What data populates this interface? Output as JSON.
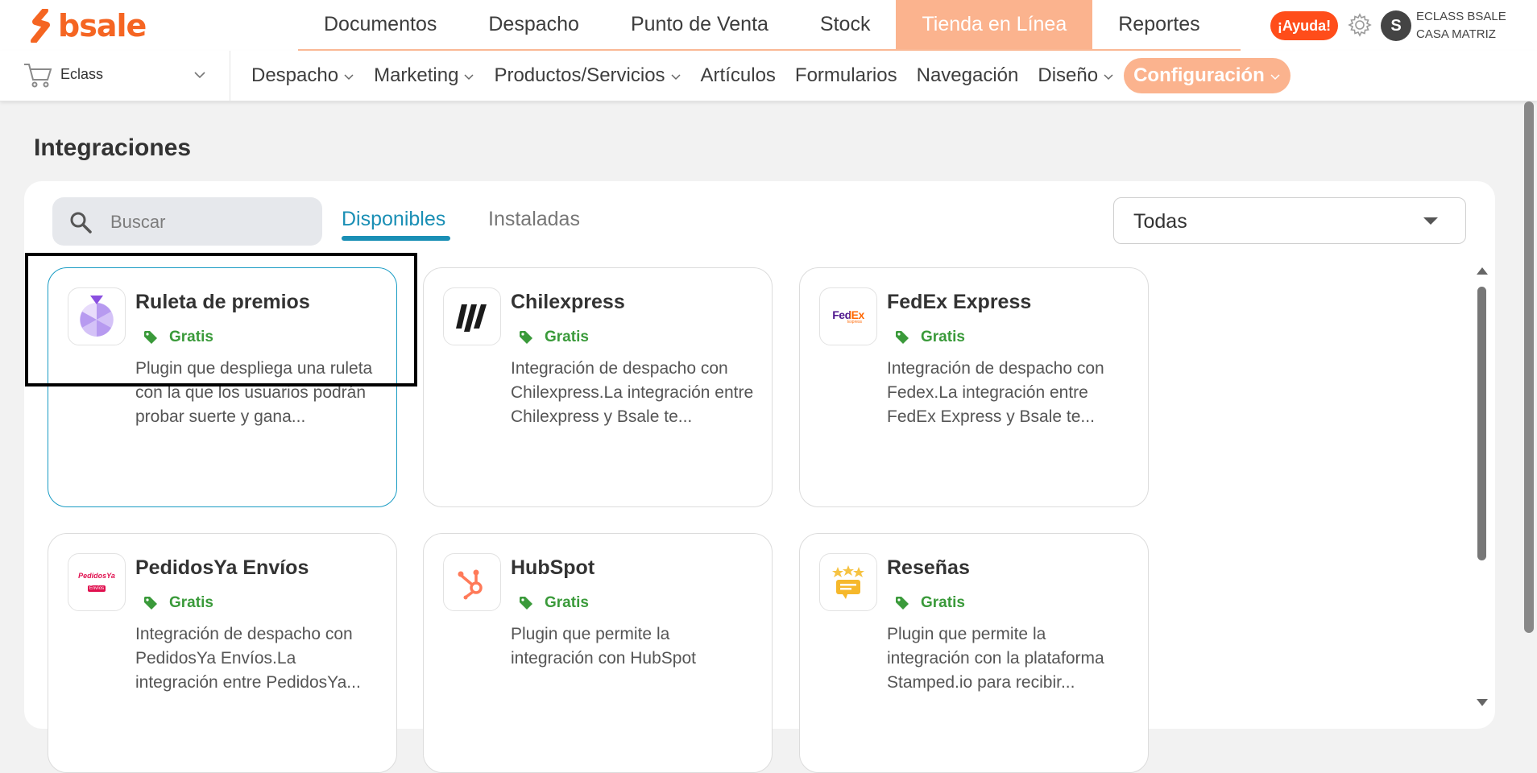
{
  "brand": {
    "name": "bsale",
    "color": "#f56522"
  },
  "main_nav": [
    {
      "label": "Documentos",
      "active": false
    },
    {
      "label": "Despacho",
      "active": false
    },
    {
      "label": "Punto de Venta",
      "active": false
    },
    {
      "label": "Stock",
      "active": false
    },
    {
      "label": "Tienda en Línea",
      "active": true
    },
    {
      "label": "Reportes",
      "active": false
    }
  ],
  "header": {
    "help_label": "¡Ayuda!",
    "avatar_initial": "S",
    "company_line1": "ECLASS BSALE",
    "company_line2": "CASA MATRIZ"
  },
  "store": {
    "name": "Eclass"
  },
  "sub_nav": [
    {
      "label": "Despacho",
      "has_menu": true,
      "active": false
    },
    {
      "label": "Marketing",
      "has_menu": true,
      "active": false
    },
    {
      "label": "Productos/Servicios",
      "has_menu": true,
      "active": false
    },
    {
      "label": "Artículos",
      "has_menu": false,
      "active": false
    },
    {
      "label": "Formularios",
      "has_menu": false,
      "active": false
    },
    {
      "label": "Navegación",
      "has_menu": false,
      "active": false
    },
    {
      "label": "Diseño",
      "has_menu": true,
      "active": false
    },
    {
      "label": "Configuración",
      "has_menu": true,
      "active": true
    }
  ],
  "page": {
    "title": "Integraciones"
  },
  "search": {
    "placeholder": "Buscar",
    "value": ""
  },
  "tabs": {
    "available": "Disponibles",
    "installed": "Instaladas",
    "active": "available"
  },
  "filter": {
    "selected": "Todas"
  },
  "integrations": [
    {
      "name": "Ruleta de premios",
      "price": "Gratis",
      "description": "Plugin que despliega una ruleta con la que los usuarios podrán probar suerte y gana...",
      "icon": "prize-wheel-icon",
      "selected": true
    },
    {
      "name": "Chilexpress",
      "price": "Gratis",
      "description": "Integración de despacho con Chilexpress.La integración entre Chilexpress y Bsale te...",
      "icon": "chilexpress-logo",
      "selected": false
    },
    {
      "name": "FedEx Express",
      "price": "Gratis",
      "description": "Integración de despacho con Fedex.La integración entre FedEx Express y Bsale te...",
      "icon": "fedex-logo",
      "selected": false,
      "logo_text": "FedEx",
      "logo_sub": "Express"
    },
    {
      "name": "PedidosYa Envíos",
      "price": "Gratis",
      "description": "Integración de despacho con PedidosYa Envíos.La integración entre PedidosYa...",
      "icon": "pedidosya-logo",
      "selected": false,
      "logo_text": "PedidosYa",
      "logo_sub": "Envíos"
    },
    {
      "name": "HubSpot",
      "price": "Gratis",
      "description": "Plugin que permite la integración con HubSpot",
      "icon": "hubspot-logo",
      "selected": false
    },
    {
      "name": "Reseñas",
      "price": "Gratis",
      "description": "Plugin que permite la integración con la plataforma Stamped.io para recibir...",
      "icon": "reviews-stars-icon",
      "selected": false
    }
  ],
  "colors": {
    "accent": "#fbb38e",
    "tab_active": "#1a8fb5",
    "price": "#3a9a3a",
    "help": "#ff4d1a"
  }
}
